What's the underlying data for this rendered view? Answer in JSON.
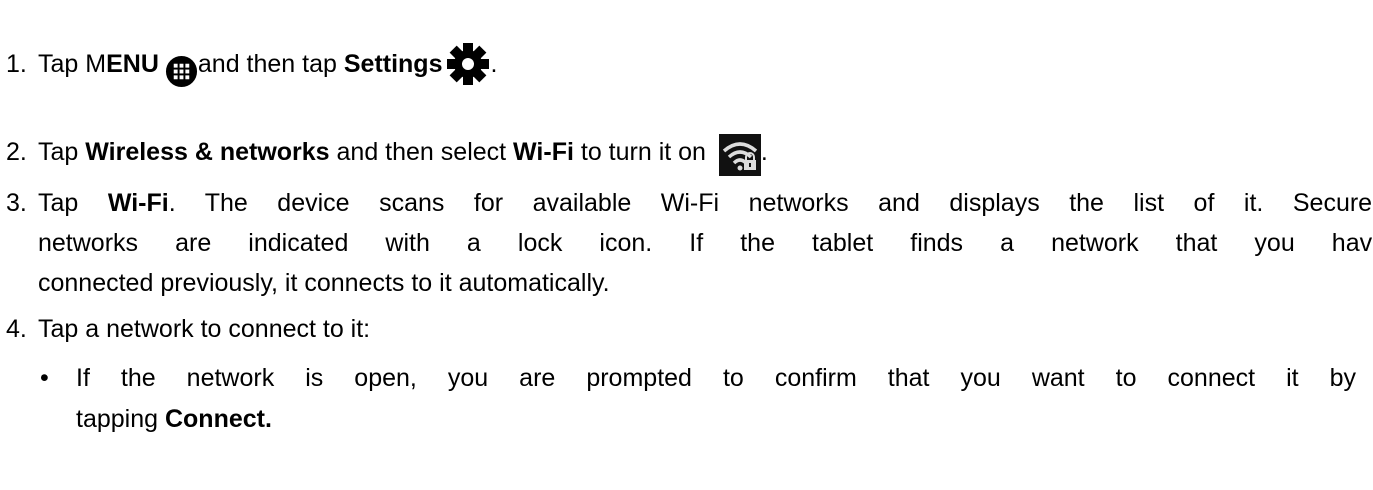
{
  "steps": [
    {
      "num": "1.",
      "tap": "Tap M",
      "menu": "ENU",
      "and_then": "and then tap ",
      "settings": "Settings",
      "end": "."
    },
    {
      "num": "2.",
      "tap": "Tap ",
      "wireless": "Wireless & networks",
      "mid": " and then select ",
      "wifi": "Wi-Fi",
      "after": " to turn it on ",
      "end": "."
    },
    {
      "num": "3.",
      "tap": "Tap ",
      "wifi": "Wi-Fi",
      "line1": ". The device scans for available Wi-Fi networks and displays the list of it. Secured",
      "line2": "networks are indicated with a lock icon. If the tablet finds a network that you have",
      "line3": "connected previously, it connects to it automatically."
    },
    {
      "num": "4.",
      "text": "Tap a network to connect to it:"
    }
  ],
  "bullets": [
    {
      "symbol": "•",
      "line1": "If the network is open, you are prompted to confirm that you want to connect it by",
      "line2_prefix": "tapping ",
      "connect": "Connect."
    }
  ],
  "icons": {
    "menu": "menu-grid-icon",
    "settings": "gear-icon",
    "wifi": "wifi-lock-icon"
  }
}
